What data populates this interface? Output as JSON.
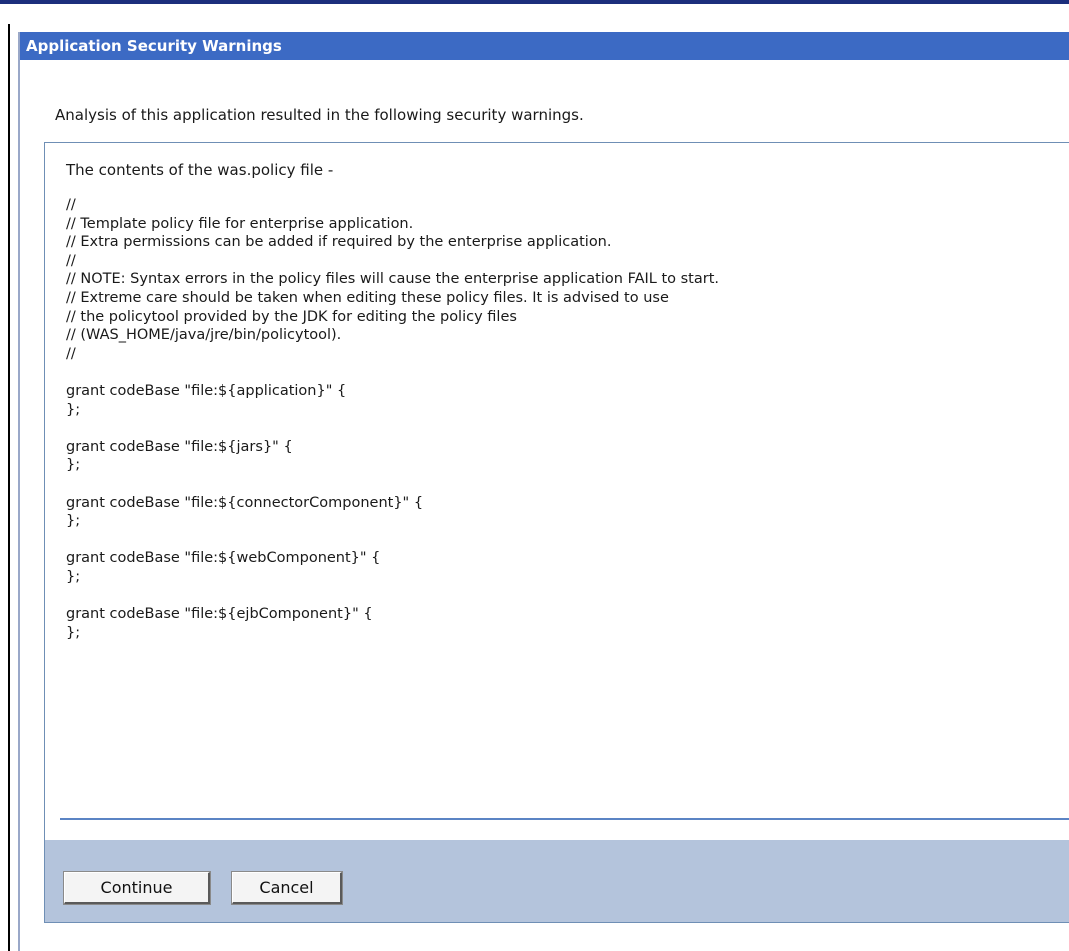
{
  "dialog": {
    "title": "Application Security Warnings",
    "intro": "Analysis of this application resulted in the following security warnings.",
    "policy_heading": "The contents of the was.policy file -",
    "policy_lines": [
      "//",
      "// Template policy file for enterprise application.",
      "// Extra permissions can be added if required by the enterprise application.",
      "//",
      "// NOTE: Syntax errors in the policy files will cause the enterprise application FAIL to start.",
      "// Extreme care should be taken when editing these policy files. It is advised to use",
      "// the policytool provided by the JDK for editing the policy files",
      "// (WAS_HOME/java/jre/bin/policytool).",
      "//",
      "",
      "grant codeBase \"file:${application}\" {",
      "};",
      "",
      "grant codeBase \"file:${jars}\" {",
      "};",
      "",
      "grant codeBase \"file:${connectorComponent}\" {",
      "};",
      "",
      "grant codeBase \"file:${webComponent}\" {",
      "};",
      "",
      "grant codeBase \"file:${ejbComponent}\" {",
      "};"
    ]
  },
  "buttons": {
    "continue_label": "Continue",
    "cancel_label": "Cancel"
  },
  "colors": {
    "titlebar": "#3c6ac4",
    "footer": "#b4c4dc",
    "separator": "#5b84c4"
  }
}
